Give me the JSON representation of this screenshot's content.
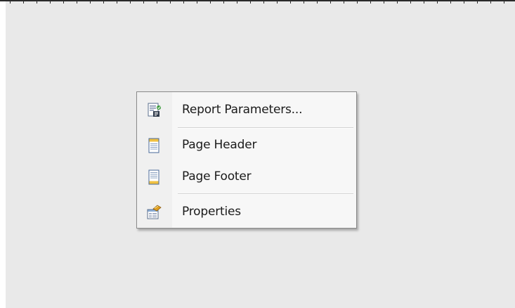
{
  "context_menu": {
    "items": [
      {
        "label": "Report Parameters...",
        "icon": "report-parameters-icon"
      },
      {
        "label": "Page Header",
        "icon": "page-header-icon"
      },
      {
        "label": "Page Footer",
        "icon": "page-footer-icon"
      },
      {
        "label": "Properties",
        "icon": "properties-icon"
      }
    ]
  },
  "colors": {
    "surface": "#e9e9e9",
    "menu_background": "#f7f7f7",
    "menu_border": "#8a8a8a",
    "text": "#1b1b1b"
  }
}
